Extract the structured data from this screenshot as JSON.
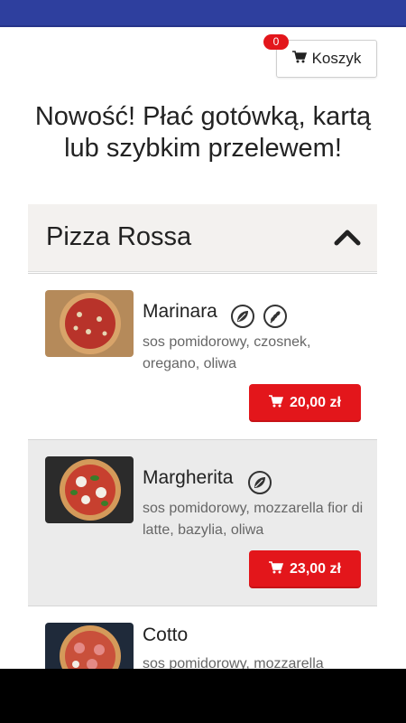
{
  "cart": {
    "label": "Koszyk",
    "count": "0"
  },
  "promo": {
    "text": "Nowość! Płać gotówką, kartą lub szybkim przelewem!"
  },
  "category": {
    "title": "Pizza Rossa"
  },
  "items": [
    {
      "name": "Marinara",
      "description": "sos pomidorowy, czosnek, oregano, oliwa",
      "price": "20,00 zł",
      "badges": [
        "vegan-leaf-icon",
        "vegetarian-wheat-icon"
      ]
    },
    {
      "name": "Margherita",
      "description": "sos pomidorowy, mozzarella fior di latte, bazylia, oliwa",
      "price": "23,00 zł",
      "badges": [
        "vegan-leaf-icon"
      ]
    },
    {
      "name": "Cotto",
      "description": "sos pomidorowy, mozzarella",
      "price": "",
      "badges": []
    }
  ],
  "colors": {
    "header": "#2e3f9e",
    "accent": "#e3161b",
    "category_bg": "#f3f1ef",
    "alt_row": "#ebebeb"
  }
}
